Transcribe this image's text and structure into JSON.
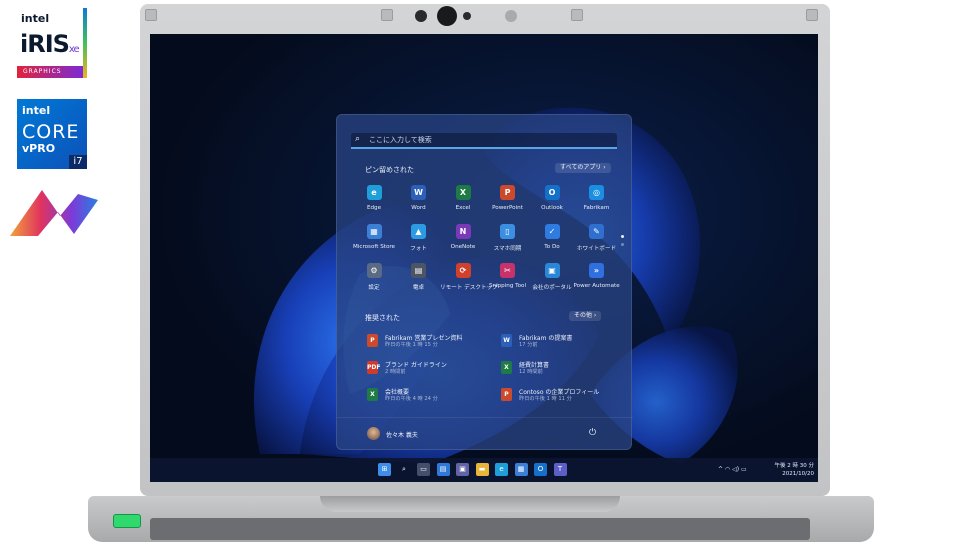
{
  "badges": {
    "iris": {
      "brand": "intel",
      "product": "iRIS",
      "sub": "xe",
      "band": "GRAPHICS"
    },
    "core": {
      "brand": "intel",
      "product": "CORE",
      "line": "vPRO",
      "tier": "i7"
    }
  },
  "start_menu": {
    "search_placeholder": "ここに入力して検索",
    "pinned_title": "ピン留めされた",
    "all_apps_label": "すべてのアプリ  ›",
    "pinned": [
      {
        "label": "Edge",
        "icon": "edge-icon",
        "color": "#1f9fd9",
        "glyph": "e"
      },
      {
        "label": "Word",
        "icon": "word-icon",
        "color": "#2b5fb8",
        "glyph": "W"
      },
      {
        "label": "Excel",
        "icon": "excel-icon",
        "color": "#1e7b45",
        "glyph": "X"
      },
      {
        "label": "PowerPoint",
        "icon": "powerpoint-icon",
        "color": "#cc4a2c",
        "glyph": "P"
      },
      {
        "label": "Outlook",
        "icon": "outlook-icon",
        "color": "#1570c9",
        "glyph": "O"
      },
      {
        "label": "Fabrikam",
        "icon": "fabrikam-icon",
        "color": "#1a8ee0",
        "glyph": "◎"
      },
      {
        "label": "Microsoft Store",
        "icon": "store-icon",
        "color": "#3b7fd6",
        "glyph": "▦"
      },
      {
        "label": "フォト",
        "icon": "photos-icon",
        "color": "#2d9be4",
        "glyph": "▲"
      },
      {
        "label": "OneNote",
        "icon": "onenote-icon",
        "color": "#7a3ab8",
        "glyph": "N"
      },
      {
        "label": "スマホ同期",
        "icon": "phone-link-icon",
        "color": "#3a8fe3",
        "glyph": "▯"
      },
      {
        "label": "To Do",
        "icon": "todo-icon",
        "color": "#2f7ce0",
        "glyph": "✓"
      },
      {
        "label": "ホワイトボード",
        "icon": "whiteboard-icon",
        "color": "#2f6fcf",
        "glyph": "✎"
      },
      {
        "label": "設定",
        "icon": "settings-icon",
        "color": "#5b6a84",
        "glyph": "⚙"
      },
      {
        "label": "電卓",
        "icon": "calculator-icon",
        "color": "#4d5564",
        "glyph": "▤"
      },
      {
        "label": "リモート デスクトップ",
        "icon": "remote-desktop-icon",
        "color": "#d0402a",
        "glyph": "⟳"
      },
      {
        "label": "Snipping Tool",
        "icon": "snipping-tool-icon",
        "color": "#c8326a",
        "glyph": "✂"
      },
      {
        "label": "会社のポータル",
        "icon": "company-portal-icon",
        "color": "#2a86d6",
        "glyph": "▣"
      },
      {
        "label": "Power Automate",
        "icon": "power-automate-icon",
        "color": "#2f6fe0",
        "glyph": "»"
      }
    ],
    "recommended_title": "推奨された",
    "more_label": "その他  ›",
    "recommended": [
      {
        "name": "Fabrikam 営業プレゼン資料",
        "time": "昨日の午後 1 時 15 分",
        "icon": "powerpoint-file-icon",
        "color": "#cc4a2c",
        "glyph": "P"
      },
      {
        "name": "Fabrikam の提案書",
        "time": "17 分前",
        "icon": "word-file-icon",
        "color": "#2b5fb8",
        "glyph": "W"
      },
      {
        "name": "ブランド ガイドライン",
        "time": "2 時間前",
        "icon": "pdf-file-icon",
        "color": "#d33a2c",
        "glyph": "PDF"
      },
      {
        "name": "経費計算書",
        "time": "12 時間前",
        "icon": "excel-file-icon",
        "color": "#1e7b45",
        "glyph": "X"
      },
      {
        "name": "会社概要",
        "time": "昨日の午後 4 時 24 分",
        "icon": "excel-file-icon",
        "color": "#1e7b45",
        "glyph": "X"
      },
      {
        "name": "Contoso の企業プロフィール",
        "time": "昨日の午後 1 時 11 分",
        "icon": "powerpoint-file-icon",
        "color": "#cc4a2c",
        "glyph": "P"
      }
    ],
    "user_name": "佐々木 義夫"
  },
  "taskbar": {
    "items": [
      {
        "icon": "windows-start-icon",
        "color": "#3c8ee8",
        "glyph": "⊞"
      },
      {
        "icon": "search-icon",
        "color": "transparent",
        "glyph": "⌕"
      },
      {
        "icon": "task-view-icon",
        "color": "#44506a",
        "glyph": "▭"
      },
      {
        "icon": "widgets-icon",
        "color": "#2f7ad8",
        "glyph": "▤"
      },
      {
        "icon": "teams-chat-icon",
        "color": "#6264a7",
        "glyph": "▣"
      },
      {
        "icon": "file-explorer-icon",
        "color": "#e8b43a",
        "glyph": "▬"
      },
      {
        "icon": "edge-icon",
        "color": "#1f9fd9",
        "glyph": "e"
      },
      {
        "icon": "store-icon",
        "color": "#3b7fd6",
        "glyph": "▦"
      },
      {
        "icon": "outlook-icon",
        "color": "#1570c9",
        "glyph": "O"
      },
      {
        "icon": "teams-icon",
        "color": "#5b5fc7",
        "glyph": "T"
      }
    ],
    "tray_glyphs": "^  ◠  ◁)  ▭",
    "time": "午後 2 時 30 分",
    "date": "2021/10/20"
  }
}
